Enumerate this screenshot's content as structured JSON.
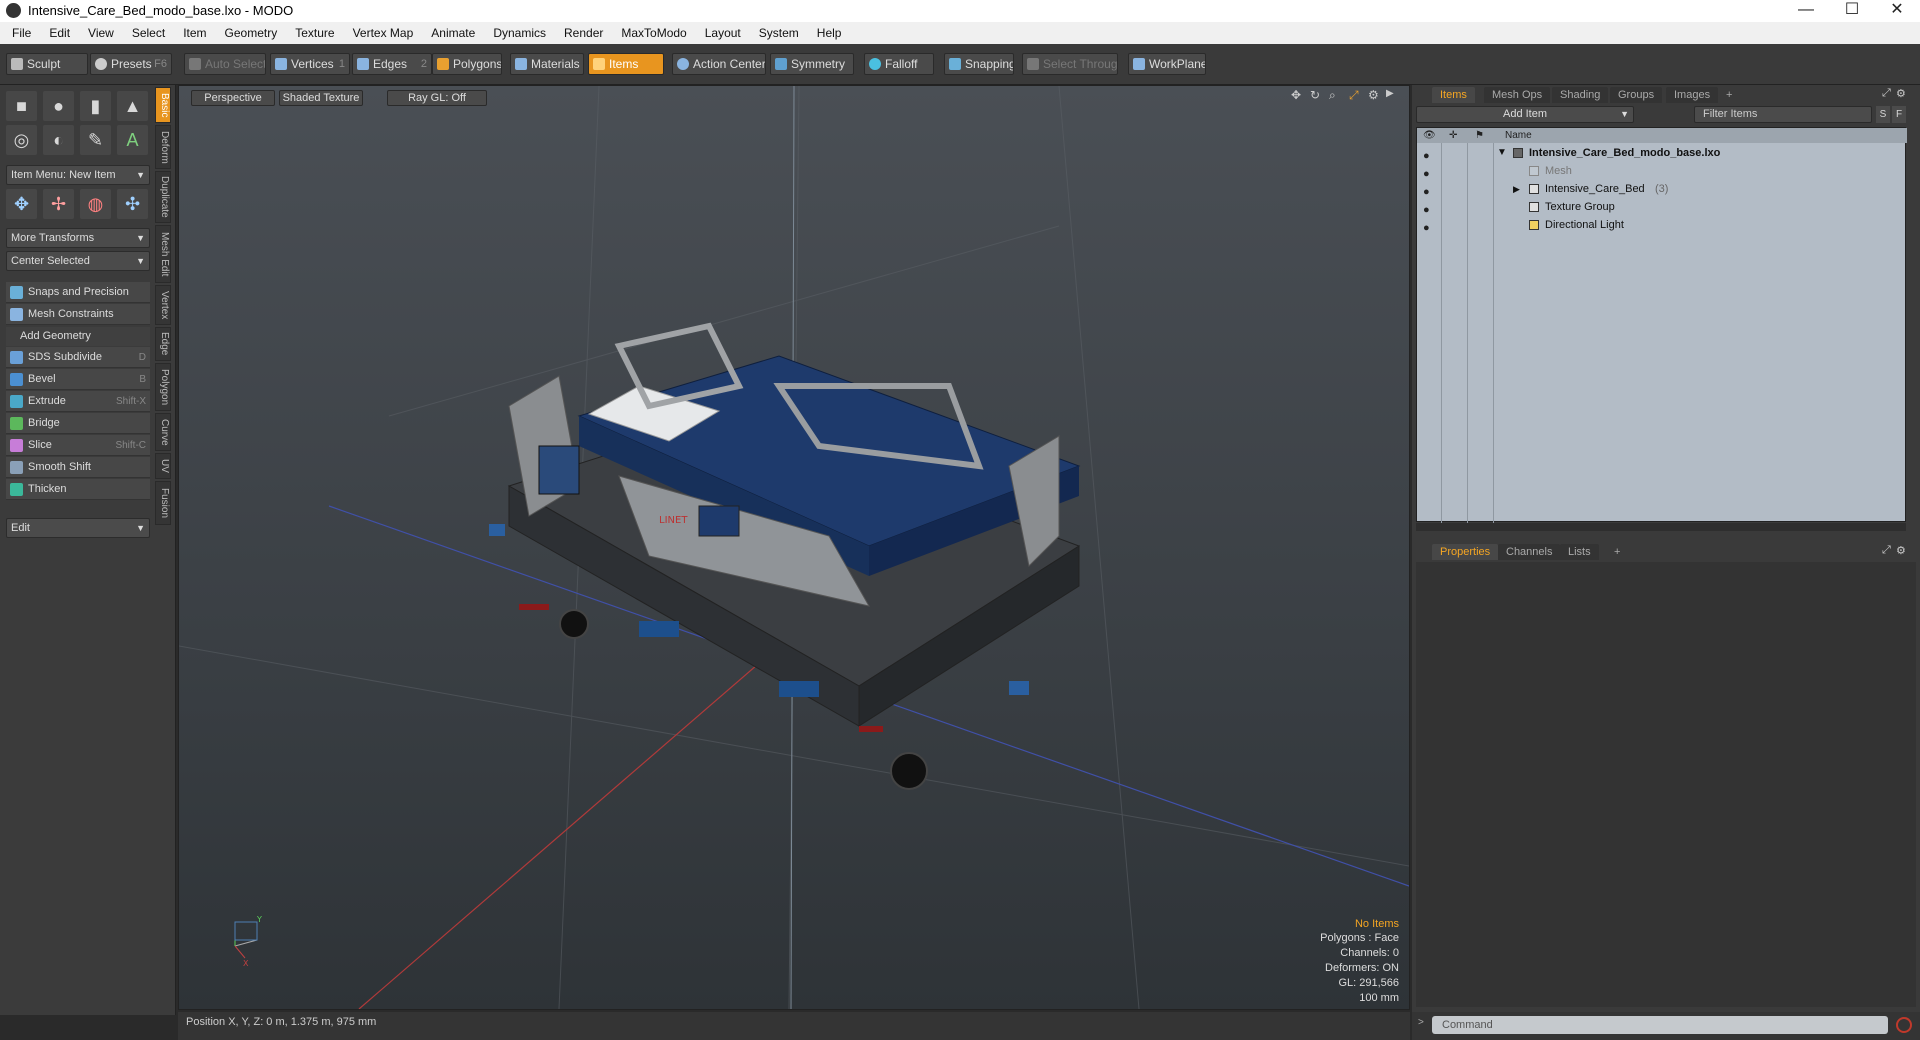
{
  "window": {
    "title": "Intensive_Care_Bed_modo_base.lxo - MODO",
    "controls": [
      "—",
      "☐",
      "✕"
    ]
  },
  "menu": [
    "File",
    "Edit",
    "View",
    "Select",
    "Item",
    "Geometry",
    "Texture",
    "Vertex Map",
    "Animate",
    "Dynamics",
    "Render",
    "MaxToModo",
    "Layout",
    "System",
    "Help"
  ],
  "toolbar": {
    "sculpt": "Sculpt",
    "presets": "Presets",
    "presets_key": "F6",
    "auto_select": "Auto Select",
    "vertices": "Vertices",
    "vertices_key": "1",
    "edges": "Edges",
    "edges_key": "2",
    "polygons": "Polygons",
    "materials": "Materials",
    "items": "Items",
    "action_center": "Action Center",
    "symmetry": "Symmetry",
    "falloff": "Falloff",
    "snapping": "Snapping",
    "select_through": "Select Through",
    "workplane": "WorkPlane"
  },
  "leftpanel": {
    "item_menu": "Item Menu: New Item",
    "more_transforms": "More Transforms",
    "center_selected": "Center Selected",
    "snaps": "Snaps and Precision",
    "mesh_constraints": "Mesh Constraints",
    "add_geometry": "Add Geometry",
    "tools": [
      {
        "label": "SDS Subdivide",
        "key": "D",
        "color": "#6aa0d8"
      },
      {
        "label": "Bevel",
        "key": "B",
        "color": "#4b8fd1"
      },
      {
        "label": "Extrude",
        "key": "Shift-X",
        "color": "#4aa8c8"
      },
      {
        "label": "Bridge",
        "key": "",
        "color": "#5cb85c"
      },
      {
        "label": "Slice",
        "key": "Shift-C",
        "color": "#c77dd8"
      },
      {
        "label": "Smooth Shift",
        "key": "",
        "color": "#8aa0b8"
      },
      {
        "label": "Thicken",
        "key": "",
        "color": "#3bb89a"
      }
    ],
    "edit": "Edit",
    "vertical_tabs": [
      "Basic",
      "Deform",
      "Duplicate",
      "Mesh Edit",
      "Vertex",
      "Edge",
      "Polygon",
      "Curve",
      "UV",
      "Fusion"
    ]
  },
  "viewport": {
    "view": "Perspective",
    "shading": "Shaded Texture",
    "raygl": "Ray GL: Off",
    "info": {
      "no_items": "No Items",
      "polygons": "Polygons : Face",
      "channels": "Channels: 0",
      "deformers": "Deformers: ON",
      "gl": "GL: 291,566",
      "scale": "100 mm"
    }
  },
  "rightpanel": {
    "tabs": [
      "Items",
      "Mesh Ops",
      "Shading",
      "Groups",
      "Images",
      "+"
    ],
    "add_item": "Add Item",
    "filter_placeholder": "Filter Items",
    "filter_s": "S",
    "filter_f": "F",
    "column_name": "Name",
    "tree": [
      {
        "label": "Intensive_Care_Bed_modo_base.lxo",
        "indent": 0
      },
      {
        "label": "Mesh",
        "indent": 1
      },
      {
        "label": "Intensive_Care_Bed",
        "count": "(3)",
        "indent": 1
      },
      {
        "label": "Texture Group",
        "indent": 1
      },
      {
        "label": "Directional Light",
        "indent": 1
      }
    ],
    "bottom_tabs": [
      "Properties",
      "Channels",
      "Lists",
      "+"
    ]
  },
  "status": {
    "position": "Position X, Y, Z:   0 m, 1.375 m, 975 mm",
    "command_placeholder": "Command"
  }
}
